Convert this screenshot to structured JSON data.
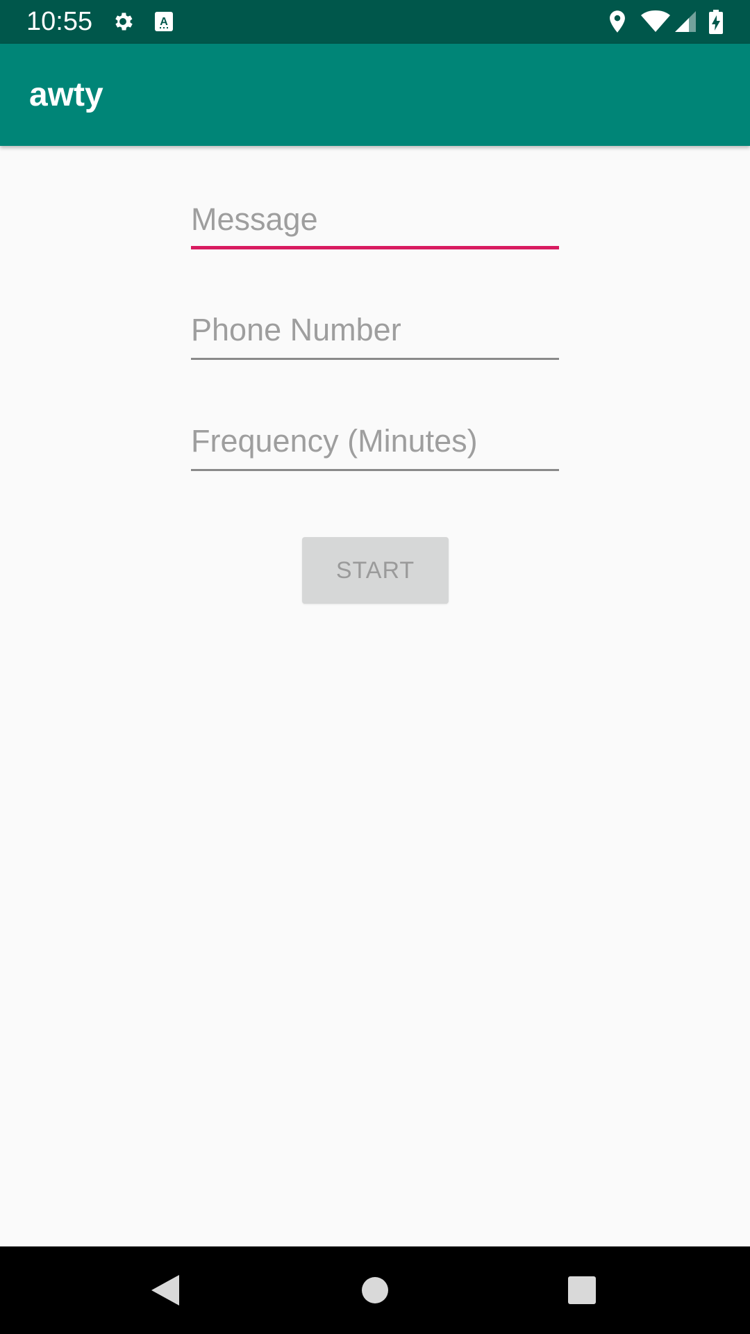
{
  "status_bar": {
    "time": "10:55",
    "icons": [
      "gear-icon",
      "keyboard-a-icon",
      "location-icon",
      "wifi-icon",
      "cell-signal-icon",
      "battery-charging-icon"
    ]
  },
  "app_bar": {
    "title": "awty",
    "background_color": "#008577",
    "status_bar_color": "#00574b"
  },
  "form": {
    "message_placeholder": "Message",
    "message_value": "",
    "phone_placeholder": "Phone Number",
    "phone_value": "",
    "frequency_placeholder": "Frequency (Minutes)",
    "frequency_value": "",
    "focused_field": "message",
    "accent_color": "#d81b60",
    "start_label": "START",
    "start_enabled": false
  },
  "nav_bar": {
    "icons": [
      "back-icon",
      "home-icon",
      "recents-icon"
    ]
  }
}
